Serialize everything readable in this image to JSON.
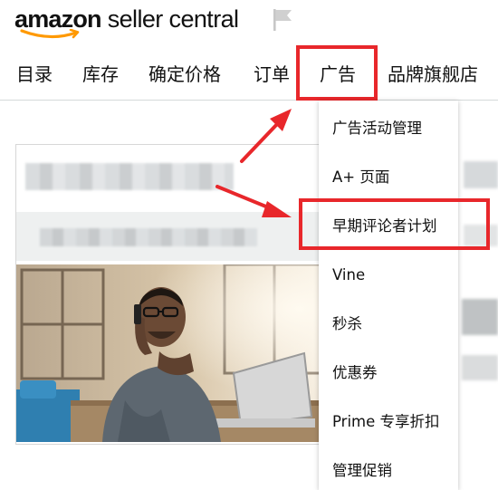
{
  "header": {
    "logo_word": "amazon",
    "logo_sub": "seller central",
    "flag_icon": "flag-icon"
  },
  "nav": {
    "items": [
      "目录",
      "库存",
      "确定价格",
      "订单",
      "广告",
      "品牌旗舰店"
    ],
    "active": "广告"
  },
  "dropdown": {
    "items": [
      "广告活动管理",
      "A+ 页面",
      "早期评论者计划",
      "Vine",
      "秒杀",
      "优惠券",
      "Prime 专享折扣",
      "管理促销"
    ],
    "highlighted": "早期评论者计划"
  },
  "colors": {
    "highlight": "#e8272b",
    "smile": "#f90",
    "divider": "#d5d9d9"
  }
}
